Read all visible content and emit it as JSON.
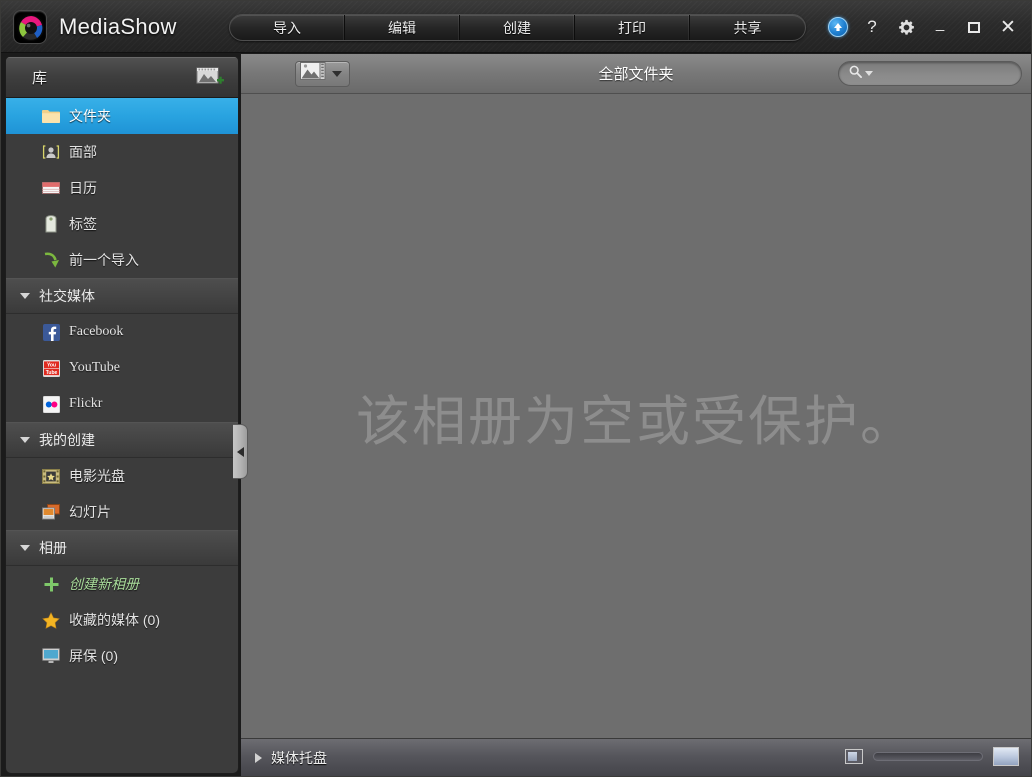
{
  "window": {
    "app_title": "MediaShow",
    "logo_icon": "camera-aperture-logo"
  },
  "titlebar": {
    "tabs": [
      {
        "label": "导入",
        "name": "tab-import"
      },
      {
        "label": "编辑",
        "name": "tab-edit"
      },
      {
        "label": "创建",
        "name": "tab-create"
      },
      {
        "label": "打印",
        "name": "tab-print"
      },
      {
        "label": "共享",
        "name": "tab-share"
      }
    ],
    "system_icons": [
      {
        "name": "upgrade-icon",
        "glyph": "↑"
      },
      {
        "name": "help-icon",
        "glyph": "?"
      },
      {
        "name": "settings-gear-icon",
        "glyph": "✿"
      },
      {
        "name": "minimize-icon",
        "glyph": "_"
      },
      {
        "name": "maximize-icon",
        "glyph": "□"
      },
      {
        "name": "close-icon",
        "glyph": "✕"
      }
    ],
    "help_glyph": "?",
    "close_glyph": "✕"
  },
  "sidebar": {
    "header_title": "库",
    "add_photo_icon": "add-photo-icon",
    "library_items": [
      {
        "label": "文件夹",
        "icon": "folder-icon",
        "selected": true
      },
      {
        "label": "面部",
        "icon": "face-icon",
        "selected": false
      },
      {
        "label": "日历",
        "icon": "calendar-icon",
        "selected": false
      },
      {
        "label": "标签",
        "icon": "tag-icon",
        "selected": false
      },
      {
        "label": "前一个导入",
        "icon": "import-arrow-icon",
        "selected": false
      }
    ],
    "sections": [
      {
        "title": "社交媒体",
        "items": [
          {
            "label": "Facebook",
            "icon": "facebook-icon"
          },
          {
            "label": "YouTube",
            "icon": "youtube-icon"
          },
          {
            "label": "Flickr",
            "icon": "flickr-icon"
          }
        ]
      },
      {
        "title": "我的创建",
        "items": [
          {
            "label": "电影光盘",
            "icon": "movie-disc-icon"
          },
          {
            "label": "幻灯片",
            "icon": "slideshow-icon"
          }
        ]
      },
      {
        "title": "相册",
        "items": [
          {
            "label": "创建新相册",
            "icon": "plus-icon"
          },
          {
            "label": "收藏的媒体 (0)",
            "icon": "star-icon"
          },
          {
            "label": "屏保 (0)",
            "icon": "screensaver-icon"
          }
        ]
      }
    ]
  },
  "content": {
    "toolbar": {
      "media_filter_icon": "photo-film-icon",
      "dropdown_caret_icon": "chevron-down-icon",
      "title": "全部文件夹",
      "search": {
        "value": "",
        "placeholder": "",
        "search_icon": "search-icon",
        "clear_icon": "close-icon",
        "clear_glyph": "✕"
      }
    },
    "empty_message": "该相册为空或受保护。",
    "collapse_handle_icon": "chevron-left-icon"
  },
  "bottom_bar": {
    "tray_label": "媒体托盘",
    "tray_toggle_icon": "chevron-right-icon",
    "zoom_small_icon": "small-thumbnail-icon",
    "zoom_large_icon": "large-thumbnail-icon",
    "zoom_slider_name": "thumbnail-size-slider"
  },
  "colors": {
    "accent_blue": "#29a3e0",
    "titlebar_dark": "#2b2b2b",
    "sidebar_bg": "#3c3c3c",
    "content_bg": "#6e6e6e",
    "empty_text": "#8d8d8d"
  }
}
